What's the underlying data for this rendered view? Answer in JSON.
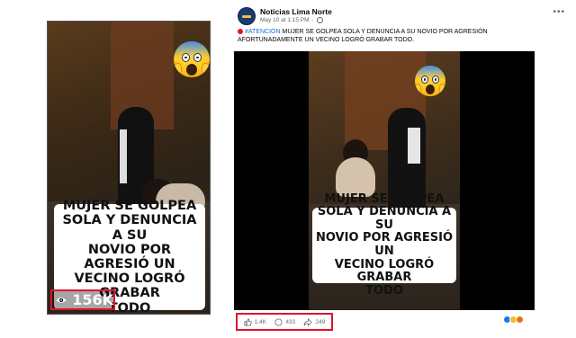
{
  "left_thumbnail": {
    "caption": "MUJER SE GOLPEA\nSOLA Y  DENUNCIA A SU\nNOVIO POR AGRESIÓ UN\nVECINO LOGRÓ GRABAR\nTODO",
    "views": {
      "icon": "eye-icon",
      "count": "156K"
    }
  },
  "post": {
    "page_name": "Noticias Lima Norte",
    "timestamp": "May 10 at 1:15 PM",
    "audience_icon": "globe-icon",
    "more_icon": "more-options-icon",
    "text": {
      "marker_icon": "red-circle-icon",
      "hashtag": "#ATENCION",
      "body": " MUJER SE GOLPEA SOLA Y DENUNCIA A SU NOVIO POR AGRESIÓN AFORTUNADAMENTE UN VECINO LOGRÓ GRABAR TODO."
    },
    "video_caption": "MUJER SE GOLPEA\nSOLA Y  DENUNCIA A SU\nNOVIO POR AGRESIÓ UN\nVECINO LOGRÓ GRABAR\nTODO",
    "stats": {
      "likes": "1.4K",
      "comments": "433",
      "shares": "249"
    },
    "reaction_icons": [
      "like-reaction-icon",
      "haha-reaction-icon",
      "angry-reaction-icon"
    ]
  },
  "colors": {
    "highlight_red": "#e0122c",
    "facebook_blue": "#216fdb"
  }
}
